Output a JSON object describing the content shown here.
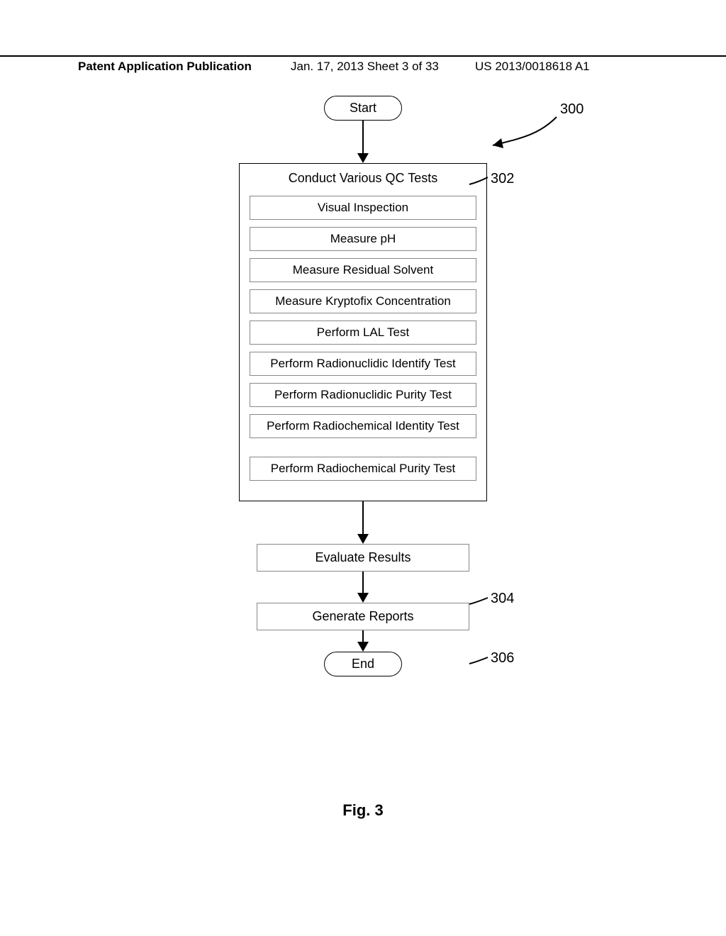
{
  "header": {
    "left": "Patent Application Publication",
    "date": "Jan. 17, 2013",
    "sheet": "Sheet 3 of 33",
    "pubno": "US 2013/0018618 A1"
  },
  "flowchart": {
    "start": "Start",
    "end": "End",
    "main_block": {
      "title": "Conduct Various QC Tests",
      "steps": [
        "Visual Inspection",
        "Measure pH",
        "Measure Residual Solvent",
        "Measure Kryptofix Concentration",
        "Perform LAL Test",
        "Perform Radionuclidic Identify Test",
        "Perform Radionuclidic Purity Test",
        "Perform Radiochemical Identity Test",
        "Perform Radiochemical Purity Test"
      ]
    },
    "step_evaluate": "Evaluate Results",
    "step_report": "Generate Reports"
  },
  "refs": {
    "overall": "300",
    "block": "302",
    "evaluate": "304",
    "report": "306"
  },
  "figure_label": "Fig. 3"
}
